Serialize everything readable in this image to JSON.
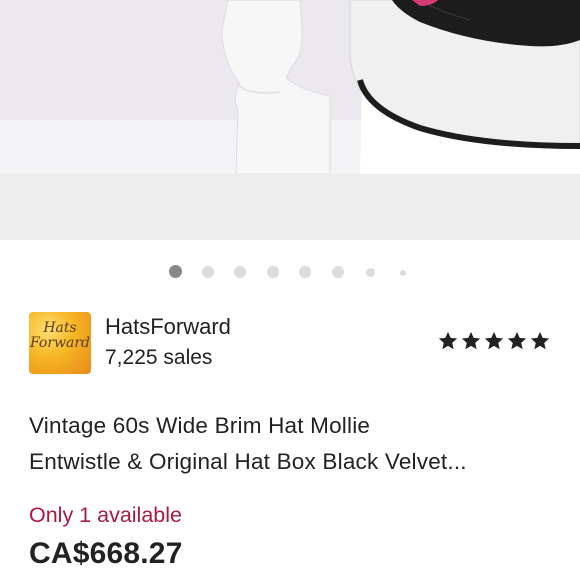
{
  "gallery": {
    "image_label": "hat-on-mannequin-photo",
    "slide_count": 8,
    "active_index": 0
  },
  "shop": {
    "name": "HatsForward",
    "sales": "7,225 sales",
    "logo_line1": "Hats",
    "logo_line2": "Forward",
    "rating": 5,
    "rating_max": 5
  },
  "listing": {
    "title_line1": "Vintage 60s Wide Brim Hat Mollie",
    "title_line2": "Entwistle & Original Hat Box Black Velvet...",
    "availability": "Only 1 available",
    "price": "CA$668.27"
  },
  "colors": {
    "availability": "#a61a44",
    "star": "#222222",
    "dot_active": "#888888",
    "dot_inactive": "#dcdcdc"
  }
}
